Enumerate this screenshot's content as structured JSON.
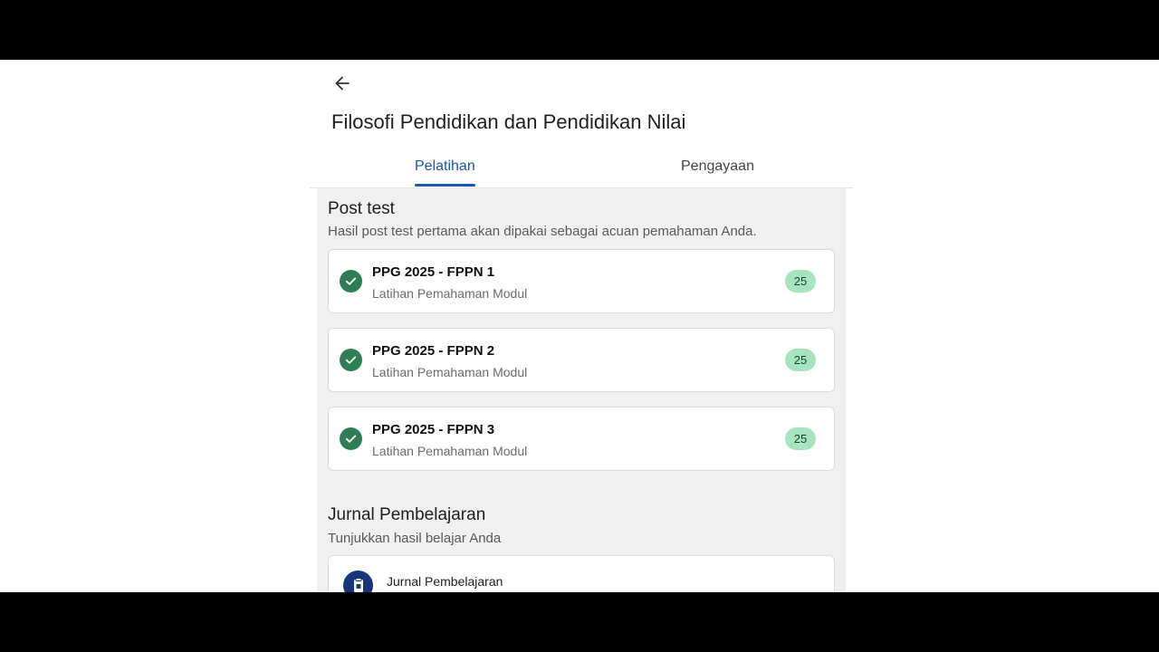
{
  "header": {
    "back_icon": "arrow-left-icon",
    "title": "Filosofi Pendidikan dan Pendidikan Nilai"
  },
  "tabs": [
    {
      "label": "Pelatihan",
      "active": true
    },
    {
      "label": "Pengayaan",
      "active": false
    }
  ],
  "post_test": {
    "title": "Post test",
    "subtitle": "Hasil post test pertama akan dipakai sebagai acuan pemahaman Anda.",
    "items": [
      {
        "title": "PPG 2025 - FPPN 1",
        "subtitle": "Latihan Pemahaman Modul",
        "score": "25",
        "status_icon": "check-circle-icon"
      },
      {
        "title": "PPG 2025 - FPPN 2",
        "subtitle": "Latihan Pemahaman Modul",
        "score": "25",
        "status_icon": "check-circle-icon"
      },
      {
        "title": "PPG 2025 - FPPN 3",
        "subtitle": "Latihan Pemahaman Modul",
        "score": "25",
        "status_icon": "check-circle-icon"
      }
    ]
  },
  "journal": {
    "title": "Jurnal Pembelajaran",
    "subtitle": "Tunjukkan hasil belajar Anda",
    "item_label": "Jurnal Pembelajaran",
    "item_icon": "journal-icon"
  },
  "colors": {
    "accent": "#1756b3",
    "check": "#2f7d56",
    "badge_bg": "#a6e3bf",
    "journal_icon_bg": "#16357a",
    "content_bg": "#f0f0f0"
  }
}
